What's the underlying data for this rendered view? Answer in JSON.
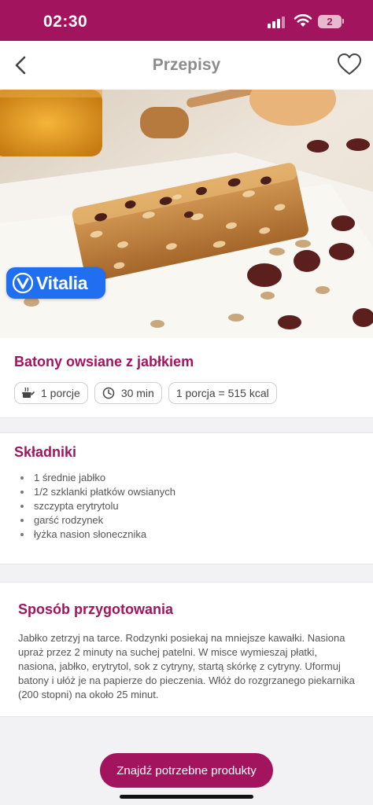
{
  "status_bar": {
    "time": "02:30",
    "battery": "2"
  },
  "nav": {
    "title": "Przepisy",
    "back_icon": "chevron-left-icon",
    "favorite_icon": "heart-outline-icon"
  },
  "hero": {
    "badge_text": "Vitalia",
    "badge_color": "#1f6ff0"
  },
  "recipe": {
    "title": "Batony owsiane z jabłkiem",
    "servings": "1 porcje",
    "time": "30 min",
    "calories": "1 porcja = 515 kcal"
  },
  "ingredients": {
    "title": "Składniki",
    "items": [
      "1 średnie jabłko",
      "1/2 szklanki płatków owsianych",
      "szczypta erytrytolu",
      "garść rodzynek",
      "łyżka nasion słonecznika"
    ]
  },
  "method": {
    "title": "Sposób przygotowania",
    "text": "Jabłko zetrzyj na tarce. Rodzynki posiekaj na mniejsze kawałki. Nasiona upraż przez 2 minuty na suchej patelni. W misce wymieszaj płatki, nasiona, jabłko, erytrytol, sok z cytryny, startą skórkę z cytryny. Uformuj batony i ułóż je na papierze do pieczenia. Włóż do rozgrzanego piekarnika (200 stopni) na około 25 minut."
  },
  "cta": {
    "label": "Znajdź potrzebne produkty"
  },
  "colors": {
    "brand": "#a3145e",
    "background": "#f2f2f4"
  }
}
